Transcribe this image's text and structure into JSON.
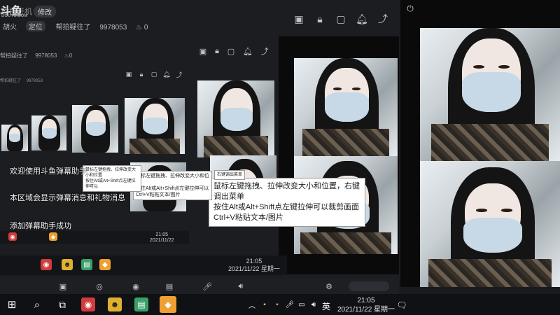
{
  "header": {
    "logo": "斗鱼",
    "logo_sub": "DOUYU.COM",
    "title_fragment": "时拍开机",
    "edit_label": "修改",
    "row2_a": "胡火",
    "row2_b": "定位",
    "row2_follow": "帮拍疑往了",
    "row2_id": "9978053",
    "row2_likes": "0",
    "row3_follow": "帮拍疑往了",
    "row3_id": "9978053",
    "row3_likes": "0",
    "row4_a": "定位",
    "row4_follow": "帮拍疑往了",
    "row4_id": "9978053"
  },
  "danmu": {
    "welcome": "欢迎使用斗鱼弹幕助手",
    "area_info": "本区域会显示弹幕消息和礼物消息",
    "added": "添加弹幕助手成功"
  },
  "tooltip": {
    "line1": "鼠标左键拖拽、拉伸改变大小和位置，右键调出菜单",
    "line2": "按住Alt或Alt+Shift点左键拉伸可以裁剪画面",
    "line3": "Ctrl+V粘贴文本/图片",
    "header_small": "右键调出菜单",
    "small_line1": "鼠标左键拖拽、拉伸改变大小和位置",
    "small_line2": "按住Alt或Alt+Shift点左键拉伸可以",
    "small_line3": "Ctrl+V粘贴文本/图片"
  },
  "taskbar": {
    "time": "21:05",
    "date": "2021/11/22 星期一",
    "ime": "英",
    "mid_time": "21:05",
    "mid_date": "2021/11/22 星期一",
    "small_time": "21:05",
    "small_date": "2021/11/22"
  },
  "icons": {
    "gift": "gift-icon",
    "lock": "lock-icon",
    "window": "window-icon",
    "bell": "bell-icon",
    "share": "share-icon",
    "power": "power-icon"
  },
  "colors": {
    "background": "#1a1b1f",
    "taskbar": "#101114",
    "accent_red": "#d23b3b",
    "accent_orange": "#f0a030"
  }
}
